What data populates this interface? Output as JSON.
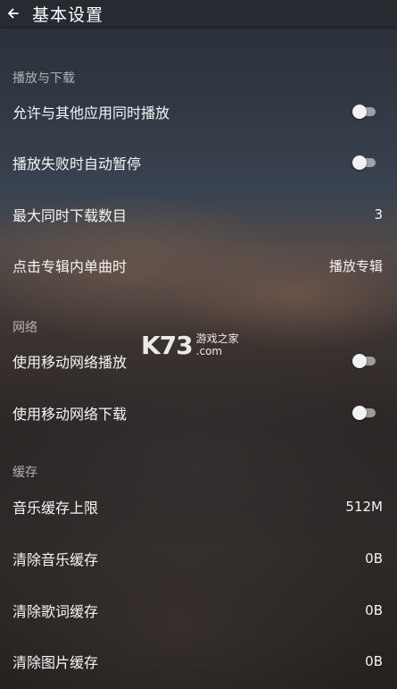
{
  "header": {
    "title": "基本设置",
    "back_icon": "arrow-left-icon"
  },
  "sections": {
    "playback": {
      "title": "播放与下载",
      "items": [
        {
          "label": "允许与其他应用同时播放",
          "control": "toggle",
          "on": false
        },
        {
          "label": "播放失败时自动暂停",
          "control": "toggle",
          "on": false
        },
        {
          "label": "最大同时下载数目",
          "value": "3"
        },
        {
          "label": "点击专辑内单曲时",
          "value": "播放专辑"
        }
      ]
    },
    "network": {
      "title": "网络",
      "items": [
        {
          "label": "使用移动网络播放",
          "control": "toggle",
          "on": false
        },
        {
          "label": "使用移动网络下载",
          "control": "toggle",
          "on": false
        }
      ]
    },
    "cache": {
      "title": "缓存",
      "items": [
        {
          "label": "音乐缓存上限",
          "value": "512M"
        },
        {
          "label": "清除音乐缓存",
          "value": "0B"
        },
        {
          "label": "清除歌词缓存",
          "value": "0B"
        },
        {
          "label": "清除图片缓存",
          "value": "0B"
        }
      ]
    }
  },
  "watermark": {
    "big": "K73",
    "small": "游戏之家",
    "domain": ".com"
  },
  "colors": {
    "topbar": "#262b31",
    "section_header": "#b0b0b0",
    "toggle_track": "#cdcdcd",
    "toggle_thumb": "#f2f2f2"
  }
}
